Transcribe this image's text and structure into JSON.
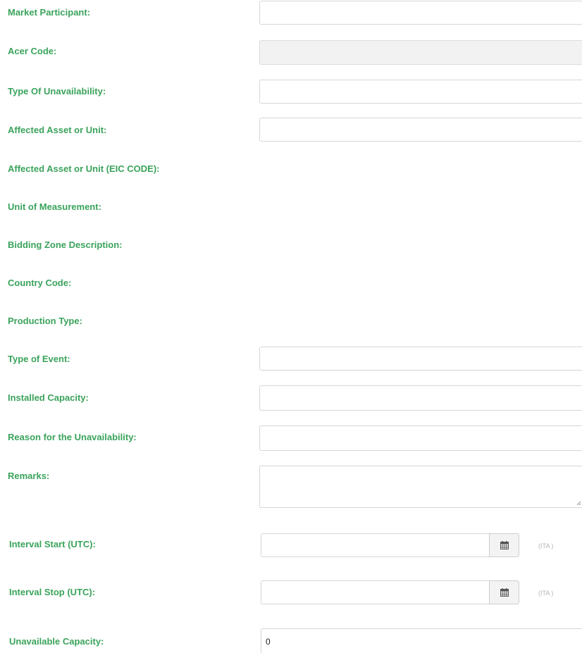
{
  "form": {
    "fields": {
      "market_participant": {
        "label": "Market Participant:",
        "value": ""
      },
      "acer_code": {
        "label": "Acer Code:",
        "value": ""
      },
      "type_of_unavailability": {
        "label": "Type Of Unavailability:",
        "value": ""
      },
      "affected_asset": {
        "label": "Affected Asset or Unit:",
        "value": ""
      },
      "affected_asset_eic": {
        "label": "Affected Asset or Unit (EIC CODE):"
      },
      "unit_of_measurement": {
        "label": "Unit of Measurement:"
      },
      "bidding_zone": {
        "label": "Bidding Zone Description:"
      },
      "country_code": {
        "label": "Country Code:"
      },
      "production_type": {
        "label": "Production Type:"
      },
      "type_of_event": {
        "label": "Type of Event:",
        "value": ""
      },
      "installed_capacity": {
        "label": "Installed Capacity:",
        "value": ""
      },
      "reason": {
        "label": "Reason for the Unavailability:",
        "value": ""
      },
      "remarks": {
        "label": "Remarks:",
        "value": ""
      },
      "interval_start": {
        "label": "Interval Start (UTC):",
        "value": "",
        "tz": "(ITA )"
      },
      "interval_stop": {
        "label": "Interval Stop (UTC):",
        "value": "",
        "tz": "(ITA )"
      },
      "unavailable_capacity": {
        "label": "Unavailable Capacity:",
        "value": "0"
      }
    }
  },
  "icons": {
    "dropdown": "chevron-down-icon",
    "calendar": "calendar-icon",
    "resize": "resize-grip-icon"
  },
  "colors": {
    "label": "#3aa35b",
    "border": "#d6d6d6",
    "readonly_bg": "#f2f2f2"
  }
}
